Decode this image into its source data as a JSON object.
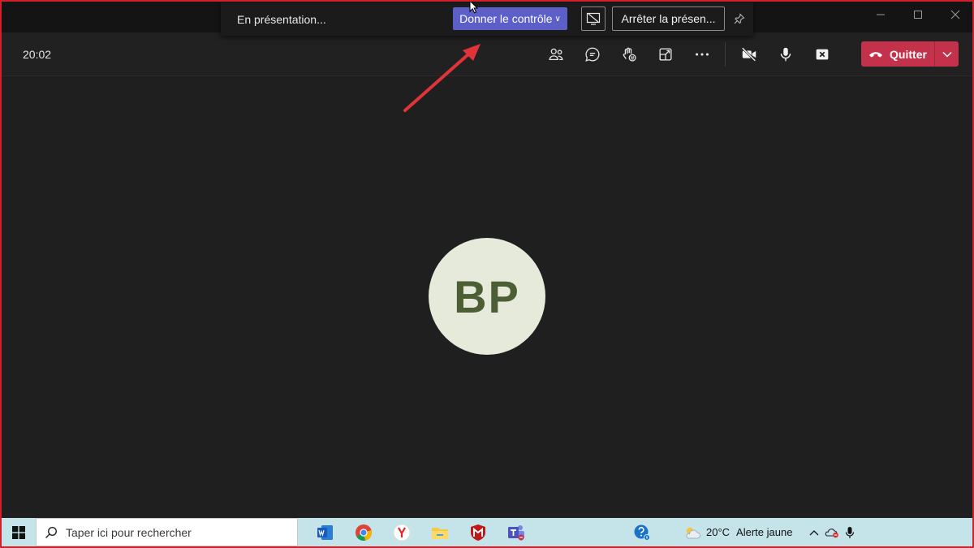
{
  "meeting": {
    "timer": "20:02",
    "quit_label": "Quitter"
  },
  "presenting": {
    "status": "En présentation...",
    "give_control": "Donner le contrôle",
    "stop": "Arrêter la présen..."
  },
  "participant": {
    "initials": "BP"
  },
  "taskbar": {
    "search_placeholder": "Taper ici pour rechercher",
    "weather_temp": "20°C",
    "weather_alert": "Alerte jaune"
  },
  "colors": {
    "accent": "#5b5fc7",
    "quit": "#c4314b",
    "avatar_bg": "#e5eada",
    "avatar_text": "#4c5e34",
    "annotation_arrow": "#e0343a"
  }
}
